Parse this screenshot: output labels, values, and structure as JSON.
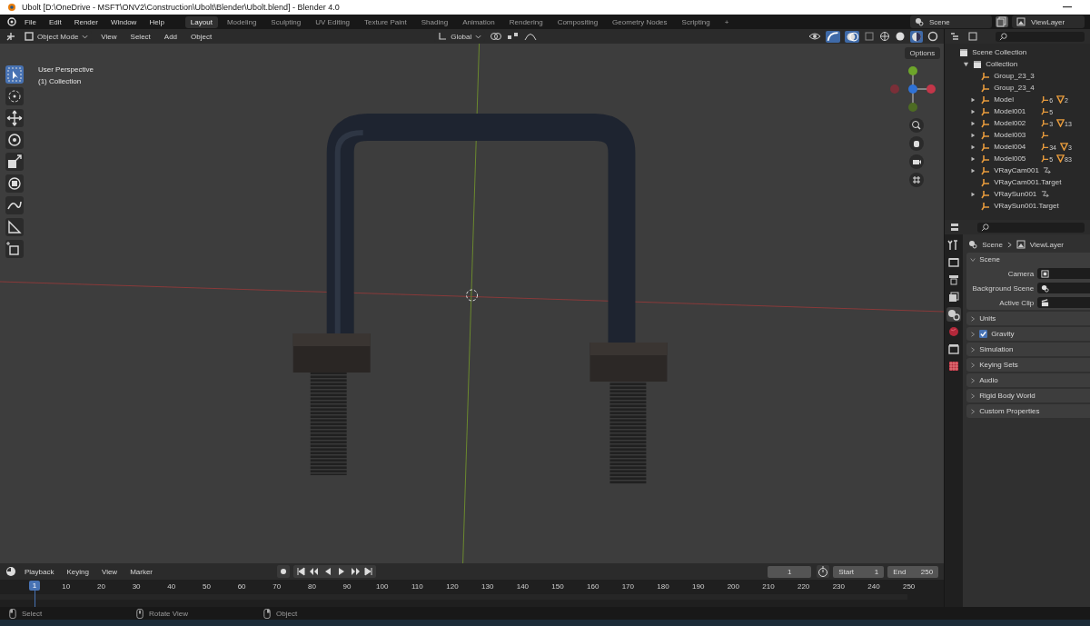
{
  "window": {
    "title": "Ubolt [D:\\OneDrive - MSFT\\ONV2\\Construction\\Ubolt\\Blender\\Ubolt.blend] - Blender 4.0"
  },
  "menu": [
    "File",
    "Edit",
    "Render",
    "Window",
    "Help"
  ],
  "workspaces": [
    {
      "label": "Layout",
      "selected": true
    },
    {
      "label": "Modeling",
      "selected": false
    },
    {
      "label": "Sculpting",
      "selected": false
    },
    {
      "label": "UV Editing",
      "selected": false
    },
    {
      "label": "Texture Paint",
      "selected": false
    },
    {
      "label": "Shading",
      "selected": false
    },
    {
      "label": "Animation",
      "selected": false
    },
    {
      "label": "Rendering",
      "selected": false
    },
    {
      "label": "Compositing",
      "selected": false
    },
    {
      "label": "Geometry Nodes",
      "selected": false
    },
    {
      "label": "Scripting",
      "selected": false
    }
  ],
  "add_workspace": "+",
  "scene_field": "Scene",
  "view_layer_field": "ViewLayer",
  "viewport": {
    "mode": "Object Mode",
    "menus": [
      "View",
      "Select",
      "Add",
      "Object"
    ],
    "orientation": "Global",
    "info": [
      "User Perspective",
      "(1) Collection"
    ],
    "options": "Options",
    "tools": [
      {
        "kind": "select",
        "selected": true
      },
      {
        "kind": "cursor",
        "selected": false
      },
      {
        "kind": "move",
        "selected": false
      },
      {
        "kind": "rotate",
        "selected": false
      },
      {
        "kind": "scale",
        "selected": false
      },
      {
        "kind": "transform",
        "selected": false
      },
      {
        "kind": "annotate",
        "selected": false
      },
      {
        "kind": "measure",
        "selected": false
      },
      {
        "kind": "add-cube",
        "selected": false
      }
    ]
  },
  "outliner": {
    "root": "Scene Collection",
    "collection": {
      "label": "Collection",
      "expanded": true,
      "children": [
        {
          "label": "Group_23_3",
          "expandable": false
        },
        {
          "label": "Group_23_4",
          "expandable": false
        },
        {
          "label": "Model",
          "expandable": true,
          "badges": [
            {
              "kind": "empty",
              "count": "6"
            },
            {
              "kind": "mesh",
              "count": "2"
            }
          ]
        },
        {
          "label": "Model001",
          "expandable": true,
          "badges": [
            {
              "kind": "empty",
              "count": "5"
            }
          ]
        },
        {
          "label": "Model002",
          "expandable": true,
          "badges": [
            {
              "kind": "empty",
              "count": "3"
            },
            {
              "kind": "mesh",
              "count": "13"
            }
          ]
        },
        {
          "label": "Model003",
          "expandable": true,
          "badges": [
            {
              "kind": "empty"
            }
          ]
        },
        {
          "label": "Model004",
          "expandable": true,
          "badges": [
            {
              "kind": "empty",
              "count": "34"
            },
            {
              "kind": "mesh",
              "count": "3"
            }
          ]
        },
        {
          "label": "Model005",
          "expandable": true,
          "badges": [
            {
              "kind": "empty",
              "count": "5"
            },
            {
              "kind": "mesh",
              "count": "83"
            }
          ]
        },
        {
          "label": "VRayCam001",
          "expandable": true,
          "badges": [
            {
              "kind": "constraint"
            }
          ]
        },
        {
          "label": "VRayCam001.Target",
          "expandable": false
        },
        {
          "label": "VRaySun001",
          "expandable": true,
          "badges": [
            {
              "kind": "constraint"
            }
          ]
        },
        {
          "label": "VRaySun001.Target",
          "expandable": false
        }
      ]
    }
  },
  "properties": {
    "tabs": [
      {
        "kind": "tool",
        "selected": false
      },
      {
        "kind": "render",
        "selected": false
      },
      {
        "kind": "output",
        "selected": false
      },
      {
        "kind": "view-layer",
        "selected": false
      },
      {
        "kind": "scene",
        "selected": true
      },
      {
        "kind": "world",
        "selected": false
      },
      {
        "kind": "collection",
        "selected": false
      },
      {
        "kind": "texture",
        "selected": false
      }
    ],
    "breadcrumb": [
      "Scene",
      "ViewLayer"
    ],
    "panels": [
      {
        "label": "Scene",
        "expanded": true,
        "fields": [
          {
            "label": "Camera",
            "kind": "camera"
          },
          {
            "label": "Background Scene",
            "kind": "scene"
          },
          {
            "label": "Active Clip",
            "kind": "clip"
          }
        ]
      },
      {
        "label": "Units",
        "expanded": false
      },
      {
        "label": "Gravity",
        "expanded": false,
        "checked": true
      },
      {
        "label": "Simulation",
        "expanded": false
      },
      {
        "label": "Keying Sets",
        "expanded": false
      },
      {
        "label": "Audio",
        "expanded": false
      },
      {
        "label": "Rigid Body World",
        "expanded": false
      },
      {
        "label": "Custom Properties",
        "expanded": false
      }
    ]
  },
  "timeline": {
    "menus": [
      "Playback",
      "Keying",
      "View",
      "Marker"
    ],
    "current_frame": "1",
    "start_label": "Start",
    "start": "1",
    "end_label": "End",
    "end": "250",
    "playhead": "1",
    "ticks": [
      "10",
      "20",
      "30",
      "40",
      "50",
      "60",
      "70",
      "80",
      "90",
      "100",
      "110",
      "120",
      "130",
      "140",
      "150",
      "160",
      "170",
      "180",
      "190",
      "200",
      "210",
      "220",
      "230",
      "240",
      "250"
    ]
  },
  "status_bar": [
    {
      "kind": "left",
      "label": "Select"
    },
    {
      "kind": "middle",
      "label": "Rotate View"
    },
    {
      "kind": "right",
      "label": "Object"
    }
  ]
}
